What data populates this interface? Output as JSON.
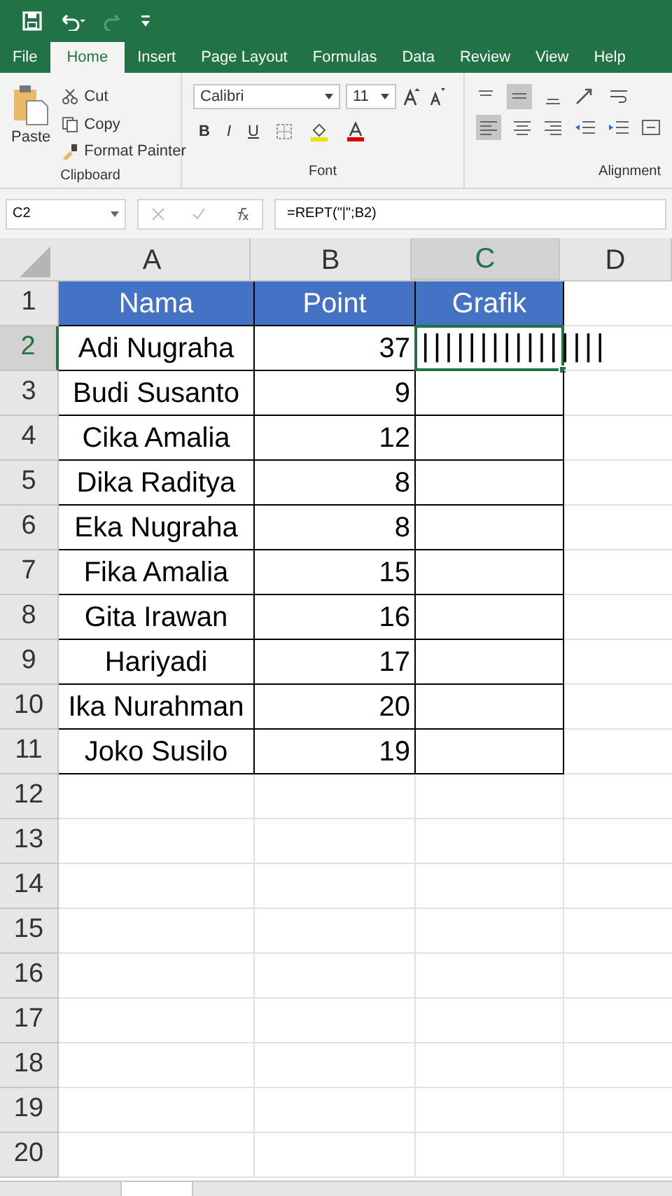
{
  "menu_tabs": [
    {
      "label": "File",
      "selected": false
    },
    {
      "label": "Home",
      "selected": true
    },
    {
      "label": "Insert",
      "selected": false
    },
    {
      "label": "Page Layout",
      "selected": false
    },
    {
      "label": "Formulas",
      "selected": false
    },
    {
      "label": "Data",
      "selected": false
    },
    {
      "label": "Review",
      "selected": false
    },
    {
      "label": "View",
      "selected": false
    },
    {
      "label": "Help",
      "selected": false
    }
  ],
  "ribbon": {
    "paste": "Paste",
    "cut": "Cut",
    "copy": "Copy",
    "format_painter": "Format Painter",
    "font_name": "Calibri",
    "font_size": "11",
    "bold": "B",
    "italic": "I",
    "underline": "U",
    "groups": [
      "Clipboard",
      "Font",
      "Alignment"
    ]
  },
  "formula_bar": {
    "name_box": "C2",
    "formula": "=REPT(\"|\";B2)"
  },
  "columns": [
    {
      "label": "A",
      "selected": false
    },
    {
      "label": "B",
      "selected": false
    },
    {
      "label": "C",
      "selected": true
    },
    {
      "label": "D",
      "selected": false
    }
  ],
  "header_row": [
    "Nama",
    "Point",
    "Grafik"
  ],
  "rows": [
    {
      "name": "Adi Nugraha",
      "point": "37",
      "grafik": "||||||||||||||||"
    },
    {
      "name": "Budi Susanto",
      "point": "9"
    },
    {
      "name": "Cika Amalia",
      "point": "12"
    },
    {
      "name": "Dika Raditya",
      "point": "8"
    },
    {
      "name": "Eka Nugraha",
      "point": "8"
    },
    {
      "name": "Fika Amalia",
      "point": "15"
    },
    {
      "name": "Gita Irawan",
      "point": "16"
    },
    {
      "name": "Hariyadi",
      "point": "17"
    },
    {
      "name": "Ika Nurahman",
      "point": "20"
    },
    {
      "name": "Joko Susilo",
      "point": "19"
    }
  ],
  "row_numbers": [
    {
      "label": "1",
      "selected": false
    },
    {
      "label": "2",
      "selected": true
    },
    {
      "label": "3",
      "selected": false
    },
    {
      "label": "4",
      "selected": false
    },
    {
      "label": "5",
      "selected": false
    },
    {
      "label": "6",
      "selected": false
    },
    {
      "label": "7",
      "selected": false
    },
    {
      "label": "8",
      "selected": false
    },
    {
      "label": "9",
      "selected": false
    },
    {
      "label": "10",
      "selected": false
    },
    {
      "label": "11",
      "selected": false
    },
    {
      "label": "12",
      "selected": false
    },
    {
      "label": "13",
      "selected": false
    },
    {
      "label": "14",
      "selected": false
    },
    {
      "label": "15",
      "selected": false
    },
    {
      "label": "16",
      "selected": false
    },
    {
      "label": "17",
      "selected": false
    },
    {
      "label": "18",
      "selected": false
    },
    {
      "label": "19",
      "selected": false
    },
    {
      "label": "20",
      "selected": false
    }
  ]
}
